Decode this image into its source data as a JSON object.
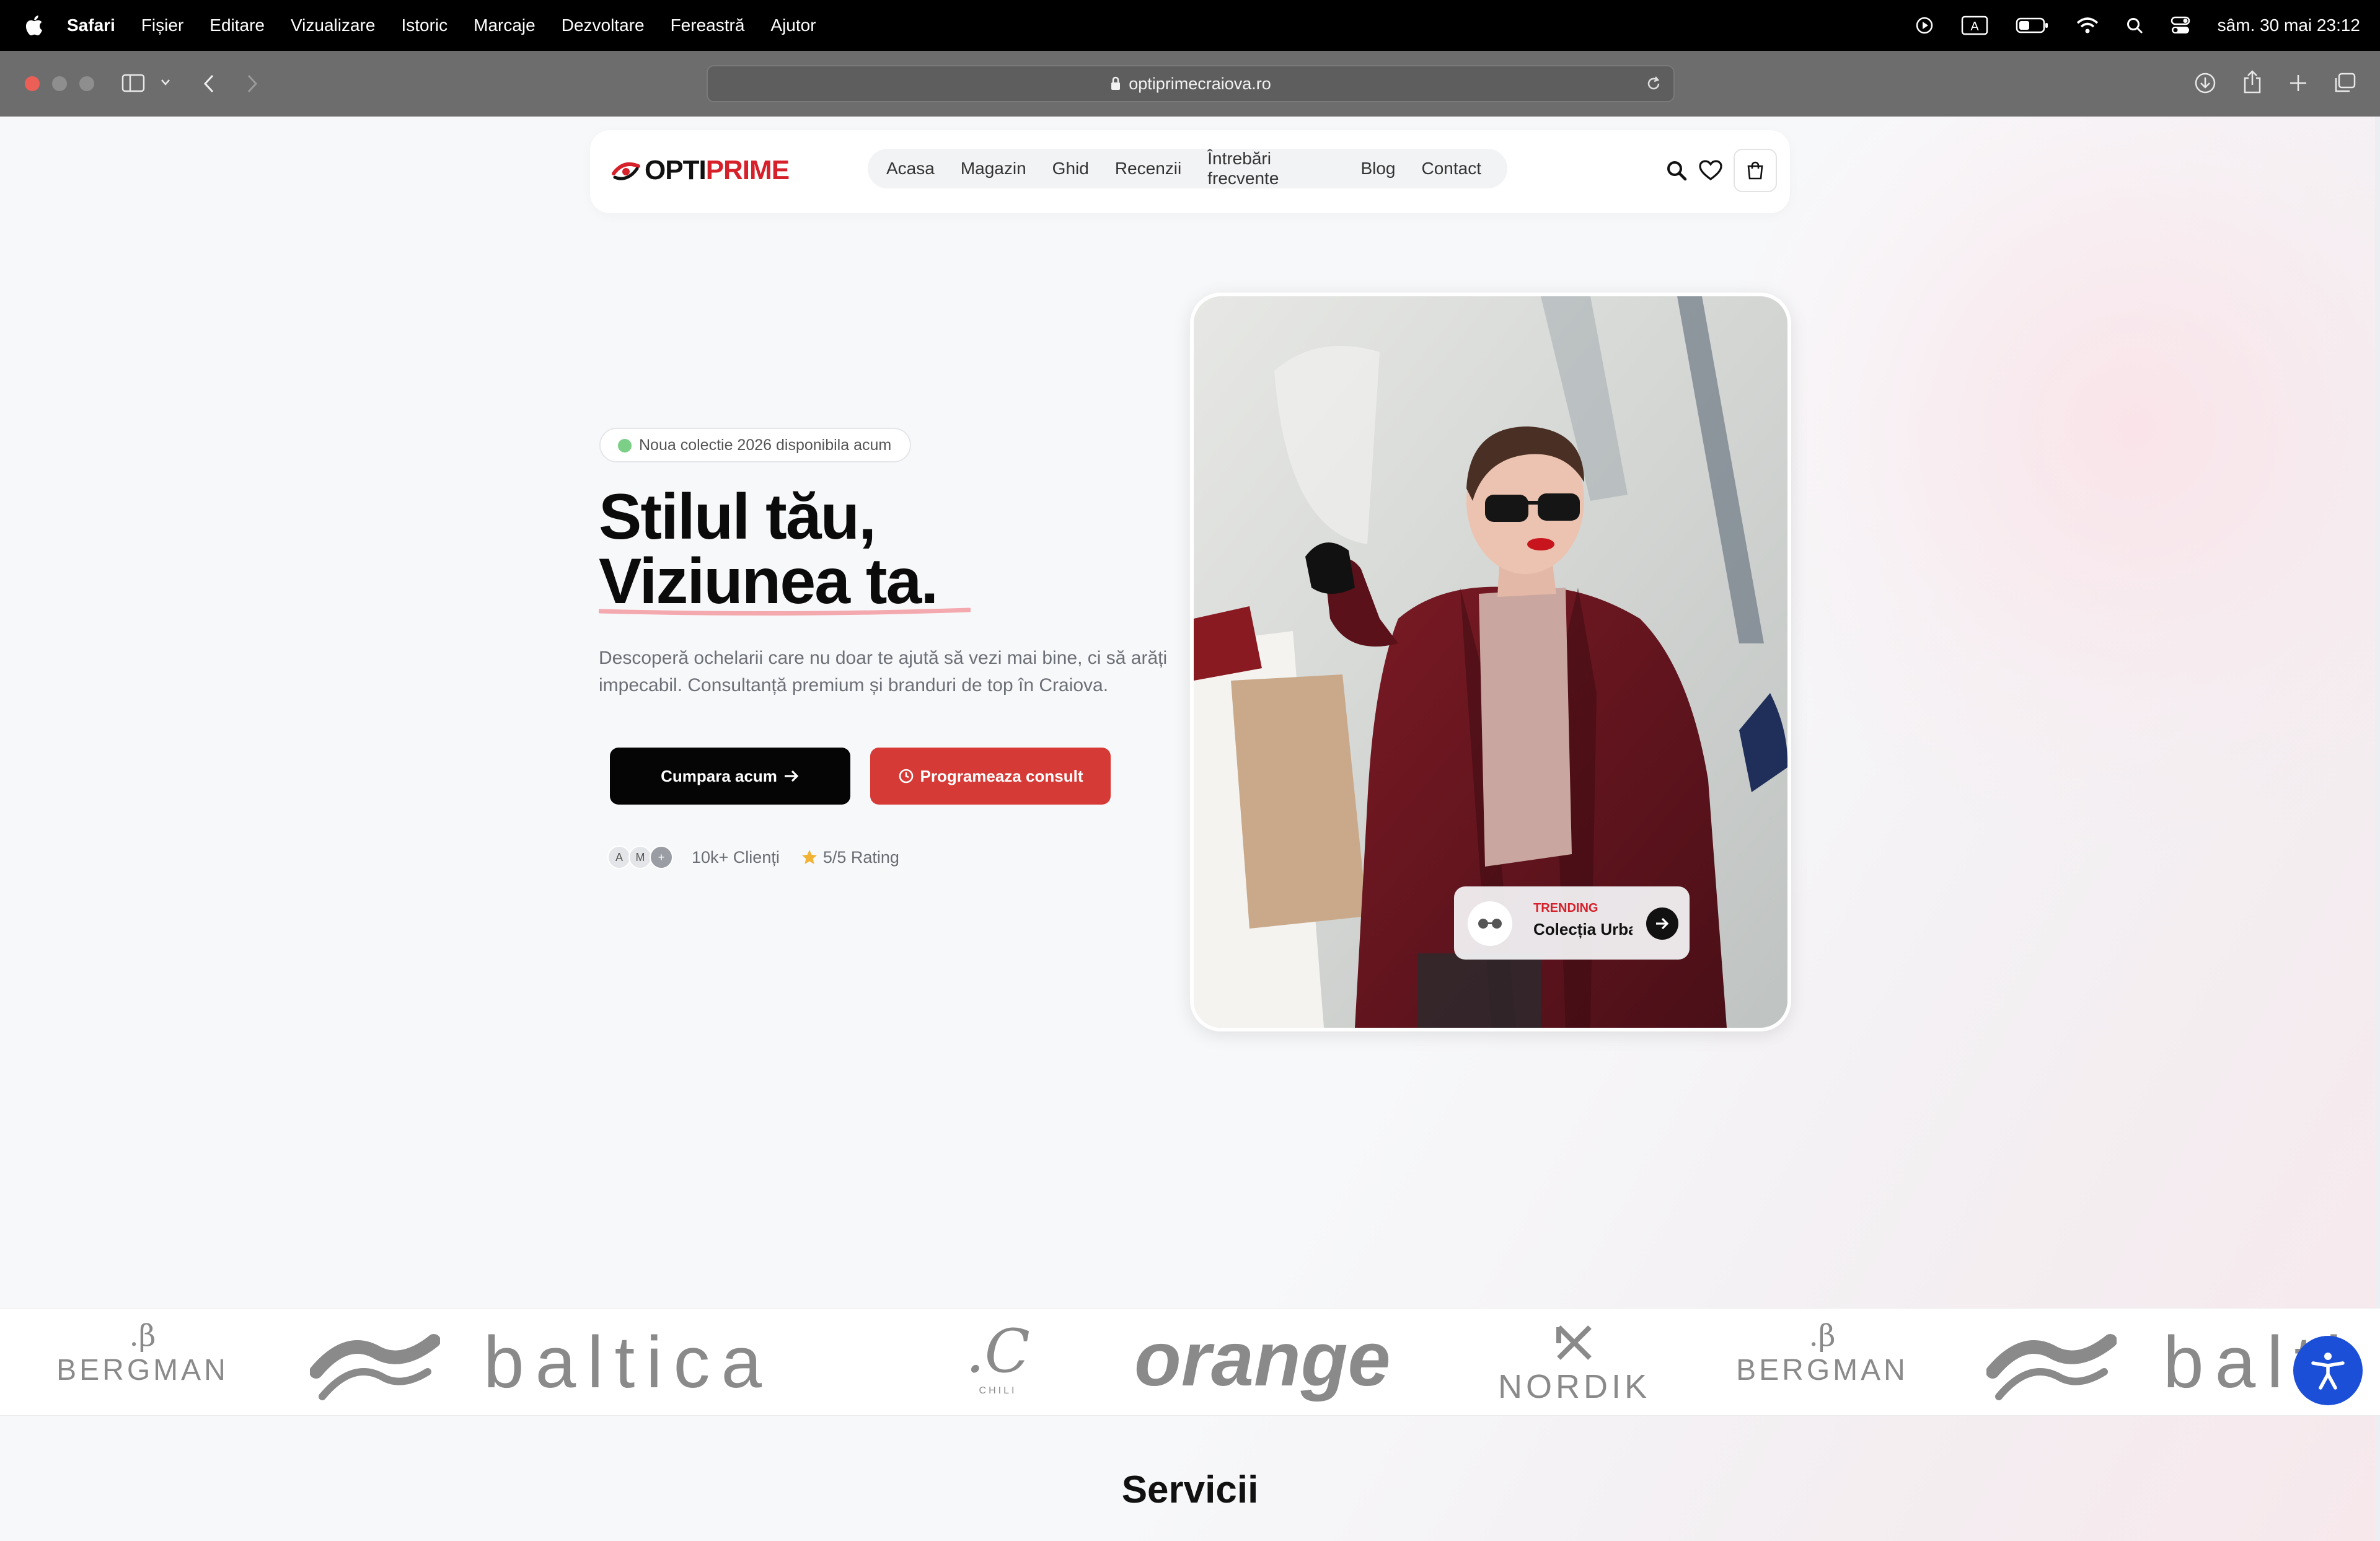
{
  "menubar": {
    "app": "Safari",
    "items": [
      "Fișier",
      "Editare",
      "Vizualizare",
      "Istoric",
      "Marcaje",
      "Dezvoltare",
      "Fereastră",
      "Ajutor"
    ],
    "status_letter": "A",
    "clock": "sâm. 30 mai  23:12"
  },
  "browser": {
    "url": "optiprimecraiova.ro",
    "traffic_colors": [
      "#ec5f57",
      "#8e8e8e",
      "#8e8e8e"
    ]
  },
  "site": {
    "logo": {
      "part1": "OPTI",
      "part2": "PRIME"
    },
    "nav": [
      "Acasa",
      "Magazin",
      "Ghid",
      "Recenzii",
      "Întrebări frecvente",
      "Blog",
      "Contact"
    ],
    "icons": [
      "search-icon",
      "heart-icon",
      "shopping-bag-icon"
    ]
  },
  "hero": {
    "badge": "Noua colectie 2026 disponibila acum",
    "title_line1": "Stilul tău,",
    "title_line2": "Viziunea ta.",
    "description": "Descoperă ochelarii care nu doar te ajută să vezi mai bine, ci să arăți impecabil. Consultanță premium și branduri de top în Craiova.",
    "btn_primary": "Cumpara acum",
    "btn_secondary": "Programeaza consult",
    "avatars": [
      "A",
      "M",
      "+"
    ],
    "clients": "10k+ Clienți",
    "rating": "5/5 Rating",
    "trending": {
      "label": "TRENDING",
      "title": "Colecția Urban"
    }
  },
  "brands": [
    {
      "name": "BERGMAN",
      "mark": ".β"
    },
    {
      "name": "baltica"
    },
    {
      "name": "CHILI",
      "mark": ".C"
    },
    {
      "name": "orange"
    },
    {
      "name": "NORDIK"
    },
    {
      "name": "BERGMAN",
      "mark": ".β"
    },
    {
      "name": "balti"
    }
  ],
  "services": {
    "title": "Servicii"
  },
  "colors": {
    "accent_red": "#d6202a",
    "button_red": "#d63a36",
    "a11y_blue": "#1b4fd8"
  }
}
